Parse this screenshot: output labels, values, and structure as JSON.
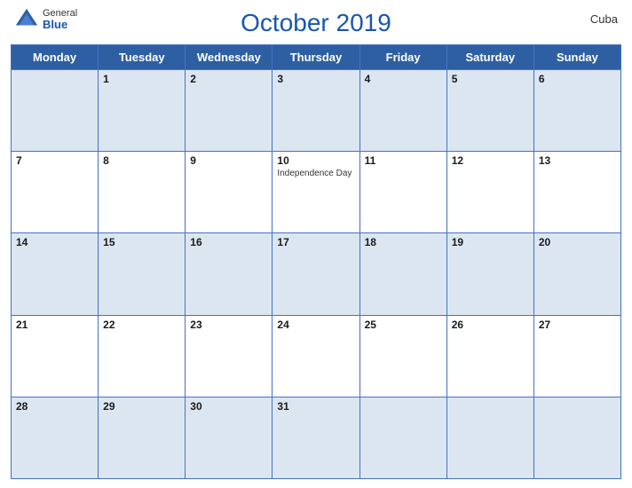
{
  "header": {
    "title": "October 2019",
    "country": "Cuba",
    "logo": {
      "general": "General",
      "blue": "Blue"
    }
  },
  "calendar": {
    "days_of_week": [
      "Monday",
      "Tuesday",
      "Wednesday",
      "Thursday",
      "Friday",
      "Saturday",
      "Sunday"
    ],
    "weeks": [
      [
        {
          "day": "",
          "empty": true
        },
        {
          "day": "1"
        },
        {
          "day": "2"
        },
        {
          "day": "3"
        },
        {
          "day": "4"
        },
        {
          "day": "5"
        },
        {
          "day": "6"
        }
      ],
      [
        {
          "day": "7"
        },
        {
          "day": "8"
        },
        {
          "day": "9"
        },
        {
          "day": "10",
          "holiday": "Independence Day"
        },
        {
          "day": "11"
        },
        {
          "day": "12"
        },
        {
          "day": "13"
        }
      ],
      [
        {
          "day": "14"
        },
        {
          "day": "15"
        },
        {
          "day": "16"
        },
        {
          "day": "17"
        },
        {
          "day": "18"
        },
        {
          "day": "19"
        },
        {
          "day": "20"
        }
      ],
      [
        {
          "day": "21"
        },
        {
          "day": "22"
        },
        {
          "day": "23"
        },
        {
          "day": "24"
        },
        {
          "day": "25"
        },
        {
          "day": "26"
        },
        {
          "day": "27"
        }
      ],
      [
        {
          "day": "28"
        },
        {
          "day": "29"
        },
        {
          "day": "30"
        },
        {
          "day": "31"
        },
        {
          "day": "",
          "empty": true
        },
        {
          "day": "",
          "empty": true
        },
        {
          "day": "",
          "empty": true
        }
      ]
    ]
  }
}
